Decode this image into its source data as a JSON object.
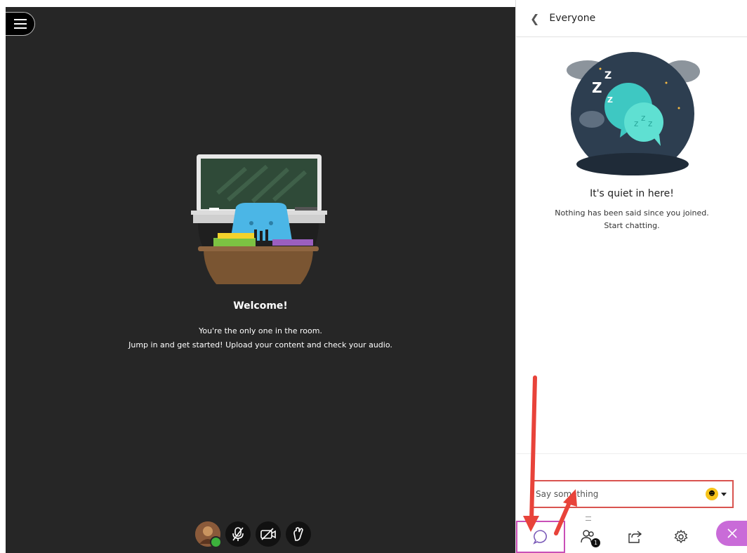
{
  "stage": {
    "welcome_title": "Welcome!",
    "line1": "You're the only one in the room.",
    "line2": "Jump in and get started! Upload your content and check your audio."
  },
  "panel": {
    "title": "Everyone",
    "quiet_title": "It's quiet in here!",
    "quiet_line1": "Nothing has been said since you joined.",
    "quiet_line2": "Start chatting.",
    "input_placeholder": "Say something",
    "attendees_badge": "1"
  },
  "icons": {
    "menu": "hamburger-menu-icon",
    "back": "chevron-left-icon",
    "emoji": "emoji-icon",
    "chat": "chat-bubble-icon",
    "attendees": "people-icon",
    "share": "share-icon",
    "settings": "gear-icon",
    "close": "close-icon"
  },
  "colors": {
    "stage_bg": "#262626",
    "accent_purple": "#c96bd8",
    "highlight_red": "#d9534f",
    "chat_tab_border": "#c94fb7"
  }
}
